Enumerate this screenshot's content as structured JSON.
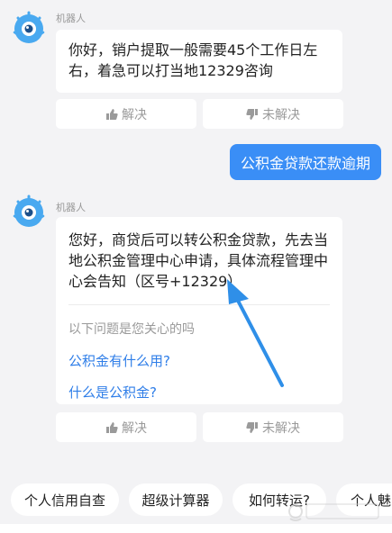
{
  "messages": [
    {
      "sender": "机器人",
      "text": "你好，销户提取一般需要45个工作日左\n右，着急可以打当地12329咨询",
      "feedback": {
        "solved": "解决",
        "unsolved": "未解决"
      }
    },
    {
      "user_text": "公积金贷款还款逾期"
    },
    {
      "sender": "机器人",
      "text": "您好，商贷后可以转公积金贷款，先去当\n地公积金管理中心申请，具体流程管理中\n心会告知（区号+12329）",
      "related_hint": "以下问题是您关心的吗",
      "related_questions": [
        "公积金有什么用?",
        "什么是公积金?"
      ],
      "feedback": {
        "solved": "解决",
        "unsolved": "未解决"
      }
    }
  ],
  "quick_chips": [
    "个人信用自查",
    "超级计算器",
    "如何转运?",
    "个人魅"
  ],
  "colors": {
    "accent": "#3a8ef6",
    "link": "#2f7ee8",
    "arrow": "#2f8fe8"
  },
  "icons": [
    "bot-avatar-icon",
    "thumb-up-icon",
    "thumb-down-icon",
    "arrow-annotation"
  ]
}
